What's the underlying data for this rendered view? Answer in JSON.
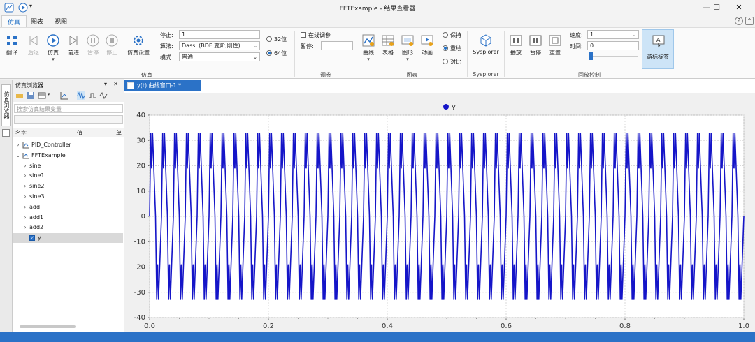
{
  "window": {
    "title": "FFTExample - 结果查看器",
    "minimize": "—",
    "maximize": "☐",
    "close": "✕"
  },
  "menu": {
    "tabs": [
      "仿真",
      "图表",
      "视图"
    ],
    "active_tab": "仿真"
  },
  "ribbon": {
    "sim_buttons": {
      "compile": "翻译",
      "back": "后退",
      "simulate": "仿真",
      "forward": "前进",
      "pause": "暂停",
      "stop": "停止",
      "settings": "仿真设置"
    },
    "sim_fields": {
      "stop_label": "停止:",
      "stop_value": "1",
      "algo_label": "算法:",
      "algo_value": "Dassl (BDF,变阶,刚性)",
      "mode_label": "模式:",
      "mode_value": "普通",
      "bit32": "32位",
      "bit64": "64位"
    },
    "group_sim": "仿真",
    "tune": {
      "online_label": "在线调参",
      "pause_label": "暂停:",
      "pause_value": ""
    },
    "group_tune": "调参",
    "chart_buttons": {
      "curve": "曲线",
      "table": "表格",
      "graph": "图形",
      "animation": "动画"
    },
    "chart_radios": {
      "keep": "保持",
      "overlay": "重绘",
      "compare": "对比"
    },
    "group_chart": "图表",
    "sysplorer_btn": "Sysplorer",
    "group_sysplorer": "Sysplorer",
    "playback_buttons": {
      "play": "播放",
      "pause": "暂停",
      "reset": "重置"
    },
    "speed_label": "速度:",
    "speed_value": "1",
    "time_label": "时间:",
    "time_value": "0",
    "cursor_label_btn": "游标标签",
    "group_playback": "回放控制"
  },
  "browser": {
    "side_tab": "仿真浏览器",
    "title": "仿真浏览器",
    "search_placeholder": "搜索仿真结果变量",
    "columns": {
      "name": "名字",
      "value": "值",
      "unit": "单"
    },
    "tree": [
      {
        "label": "PID_Controller",
        "level": 0,
        "expanded": false
      },
      {
        "label": "FFTExample",
        "level": 0,
        "expanded": true
      },
      {
        "label": "sine",
        "level": 1
      },
      {
        "label": "sine1",
        "level": 1
      },
      {
        "label": "sine2",
        "level": 1
      },
      {
        "label": "sine3",
        "level": 1
      },
      {
        "label": "add",
        "level": 1
      },
      {
        "label": "add1",
        "level": 1
      },
      {
        "label": "add2",
        "level": 1
      },
      {
        "label": "y",
        "level": 1,
        "checked": true,
        "selected": true
      }
    ]
  },
  "plot": {
    "tab_label": "y(t) 曲线窗口-1 *",
    "legend": "y",
    "line_color": "#1515c8"
  },
  "chart_data": {
    "type": "line",
    "title": "",
    "xlabel": "",
    "ylabel": "",
    "xlim": [
      0,
      1
    ],
    "ylim": [
      -40,
      40
    ],
    "xticks": [
      "0.0",
      "0.2",
      "0.4",
      "0.6",
      "0.8",
      "1.0"
    ],
    "yticks": [
      "40",
      "30",
      "20",
      "10",
      "0",
      "-10",
      "-20",
      "-30",
      "-40"
    ],
    "series": [
      {
        "name": "y",
        "description_free": true,
        "frequency_hz": 50,
        "peak": 33,
        "trough": -33,
        "shoulder": 18,
        "samples_per_period": 6
      }
    ]
  }
}
